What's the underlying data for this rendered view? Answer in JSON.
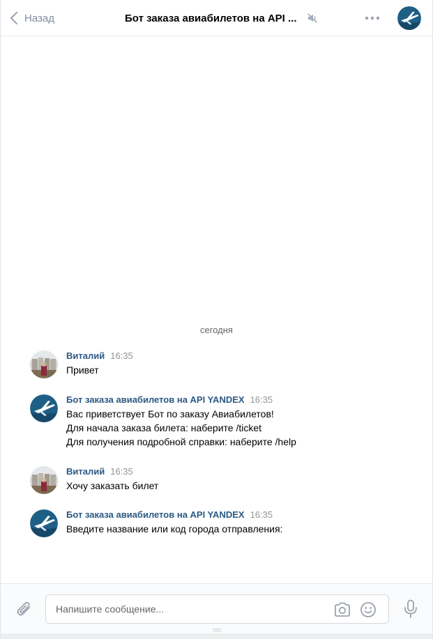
{
  "header": {
    "back_label": "Назад",
    "title": "Бот заказа авиабилетов на API ...",
    "mute_icon": "muted-speaker-icon",
    "more_icon": "more-dots-icon"
  },
  "day_separator": "сегодня",
  "messages": [
    {
      "author": "Виталий",
      "time": "16:35",
      "lines": [
        "Привет"
      ],
      "avatar": "user-photo"
    },
    {
      "author": "Бот заказа авиабилетов на API YANDEX",
      "time": "16:35",
      "lines": [
        "Вас приветствует Бот по заказу Авиабилетов!",
        "Для начала заказа билета: наберите /ticket",
        "Для получения подробной справки: наберите /help"
      ],
      "avatar": "airplane-logo"
    },
    {
      "author": "Виталий",
      "time": "16:35",
      "lines": [
        "Хочу заказать билет"
      ],
      "avatar": "user-photo"
    },
    {
      "author": "Бот заказа авиабилетов на API YANDEX",
      "time": "16:35",
      "lines": [
        "Введите название или код города отправления:"
      ],
      "avatar": "airplane-logo"
    }
  ],
  "composer": {
    "placeholder": "Напишите сообщение...",
    "value": ""
  },
  "colors": {
    "author_link": "#2a5885",
    "bot_avatar": "#1e5f86",
    "muted_text": "#818c99"
  }
}
